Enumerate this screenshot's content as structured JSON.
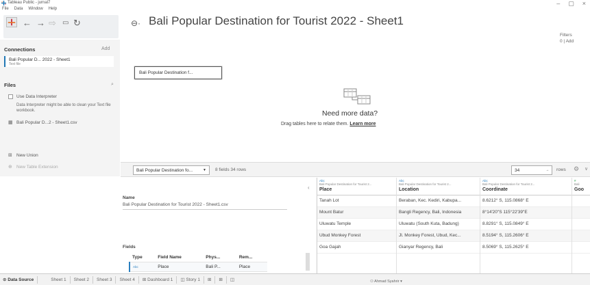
{
  "window": {
    "title": "Tableau Public - jurnal7",
    "menu": [
      "File",
      "Data",
      "Window",
      "Help"
    ],
    "controls": [
      "–",
      "▢",
      "×"
    ]
  },
  "connections": {
    "heading": "Connections",
    "add_label": "Add",
    "item_name": "Bali Popular D... 2022 - Sheet1",
    "item_type": "Text file"
  },
  "files": {
    "heading": "Files",
    "use_interpreter": "Use Data Interpreter",
    "interpreter_note": "Data Interpreter might be able to clean your Text file workbook.",
    "file_name": "Bali Popular D...2 - Sheet1.csv",
    "new_union": "New Union",
    "new_table_extension": "New Table Extension"
  },
  "main": {
    "title": "Bali Popular Destination for Tourist 2022 - Sheet1",
    "filters_label": "Filters",
    "filters_count": "0",
    "filters_add": "Add",
    "canvas_table": "Bali Popular Destination f...",
    "need_more": "Need more data?",
    "drag_text": "Drag tables here to relate them.",
    "learn_more": "Learn more"
  },
  "gridbar": {
    "table_select": "Bali Popular Destination fo...",
    "info": "8 fields 34 rows",
    "rows_value": "34",
    "rows_label": "rows"
  },
  "metadata": {
    "name_label": "Name",
    "name_value": "Bali Popular Destination for Tourist 2022 - Sheet1.csv",
    "fields_label": "Fields",
    "columns": [
      "Type",
      "Field Name",
      "Phys...",
      "Rem..."
    ],
    "rows": [
      {
        "type": "Abc",
        "field": "Place",
        "phys": "Bali P...",
        "rem": "Place"
      }
    ]
  },
  "grid": {
    "columns": [
      {
        "type": "Abc",
        "source": "Bali Popular Destination for Tourist 2...",
        "name": "Place",
        "cells": [
          "Tanah Lot",
          "Mount Batur",
          "Uluwatu Temple",
          "Ubud Monkey Forest",
          "Goa Gajah"
        ]
      },
      {
        "type": "Abc",
        "source": "Bali Popular Destination for Tourist 2...",
        "name": "Location",
        "cells": [
          "Beraban, Kec. Kediri, Kabupa...",
          "Bangli Regency, Bali, Indonesia",
          "Uluwatu (South Kuta, Badung)",
          "Jl. Monkey Forest, Ubud, Kec...",
          "Gianyar Regency, Bali"
        ]
      },
      {
        "type": "Abc",
        "source": "Bali Popular Destination for Tourist 2...",
        "name": "Coordinate",
        "cells": [
          "8.6212° S, 115.0868° E",
          "8°14'20\"S 115°22'39\"E",
          "8.8291° S, 115.0849° E",
          "8.5194° S, 115.2606° E",
          "8.5069° S, 115.2625° E"
        ]
      },
      {
        "type": "#",
        "source": "Bali",
        "name": "Goo",
        "cells": [
          "",
          "",
          "",
          "",
          ""
        ]
      }
    ]
  },
  "tabs": [
    "Data Source",
    "Sheet 1",
    "Sheet 2",
    "Sheet 3",
    "Sheet 4",
    "Dashboard 1",
    "Story 1"
  ],
  "status": {
    "user": "Ahmad Syahrir"
  }
}
